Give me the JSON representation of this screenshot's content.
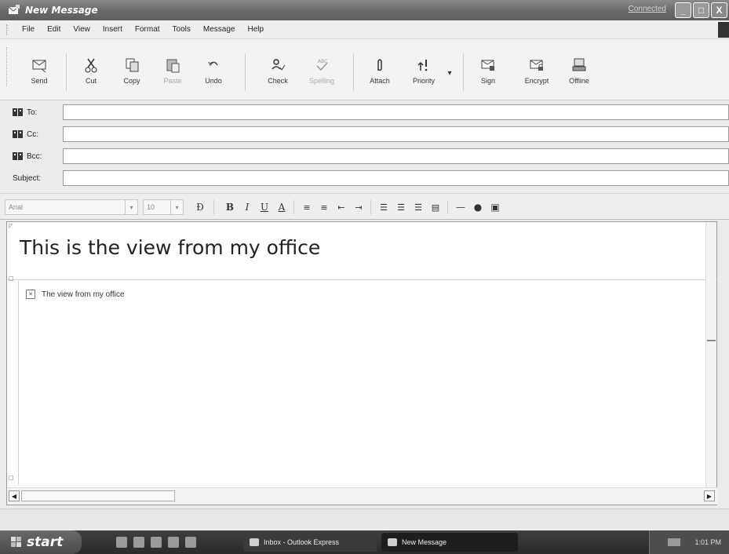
{
  "window": {
    "title": "New Message",
    "title_extra": "Connected",
    "minimize_symbol": "_",
    "maximize_symbol": "□",
    "close_symbol": "X"
  },
  "menu": [
    "File",
    "Edit",
    "View",
    "Insert",
    "Format",
    "Tools",
    "Message",
    "Help"
  ],
  "toolbar": [
    {
      "label": "Send",
      "icon": "send-icon",
      "enabled": true
    },
    {
      "label": "Cut",
      "icon": "cut-icon",
      "enabled": true
    },
    {
      "label": "Copy",
      "icon": "copy-icon",
      "enabled": true
    },
    {
      "label": "Paste",
      "icon": "paste-icon",
      "enabled": false
    },
    {
      "label": "Undo",
      "icon": "undo-icon",
      "enabled": true
    },
    {
      "label": "Check",
      "icon": "check-names-icon",
      "enabled": true
    },
    {
      "label": "Spelling",
      "icon": "spelling-icon",
      "enabled": false
    },
    {
      "label": "Attach",
      "icon": "attach-icon",
      "enabled": true
    },
    {
      "label": "Priority",
      "icon": "priority-icon",
      "enabled": true
    },
    {
      "label": "Sign",
      "icon": "sign-icon",
      "enabled": true
    },
    {
      "label": "Encrypt",
      "icon": "encrypt-icon",
      "enabled": true
    },
    {
      "label": "Offline",
      "icon": "offline-icon",
      "enabled": true
    }
  ],
  "fields": {
    "to_label": "To:",
    "cc_label": "Cc:",
    "bcc_label": "Bcc:",
    "subject_label": "Subject:",
    "to_value": "",
    "cc_value": "",
    "bcc_value": "",
    "subject_value": ""
  },
  "format": {
    "font": "Arial",
    "size": "10",
    "buttons": [
      "B",
      "I",
      "U",
      "A"
    ]
  },
  "message": {
    "heading": "This is the view from my office",
    "image_alt": "The view from my office"
  },
  "taskbar": {
    "start_label": "start",
    "tasks": [
      "Inbox - Outlook Express",
      "New Message"
    ],
    "clock": "1:01 PM"
  },
  "colors": {
    "titlebar": "#6b6b6b",
    "taskbar": "#2a2a2a"
  }
}
